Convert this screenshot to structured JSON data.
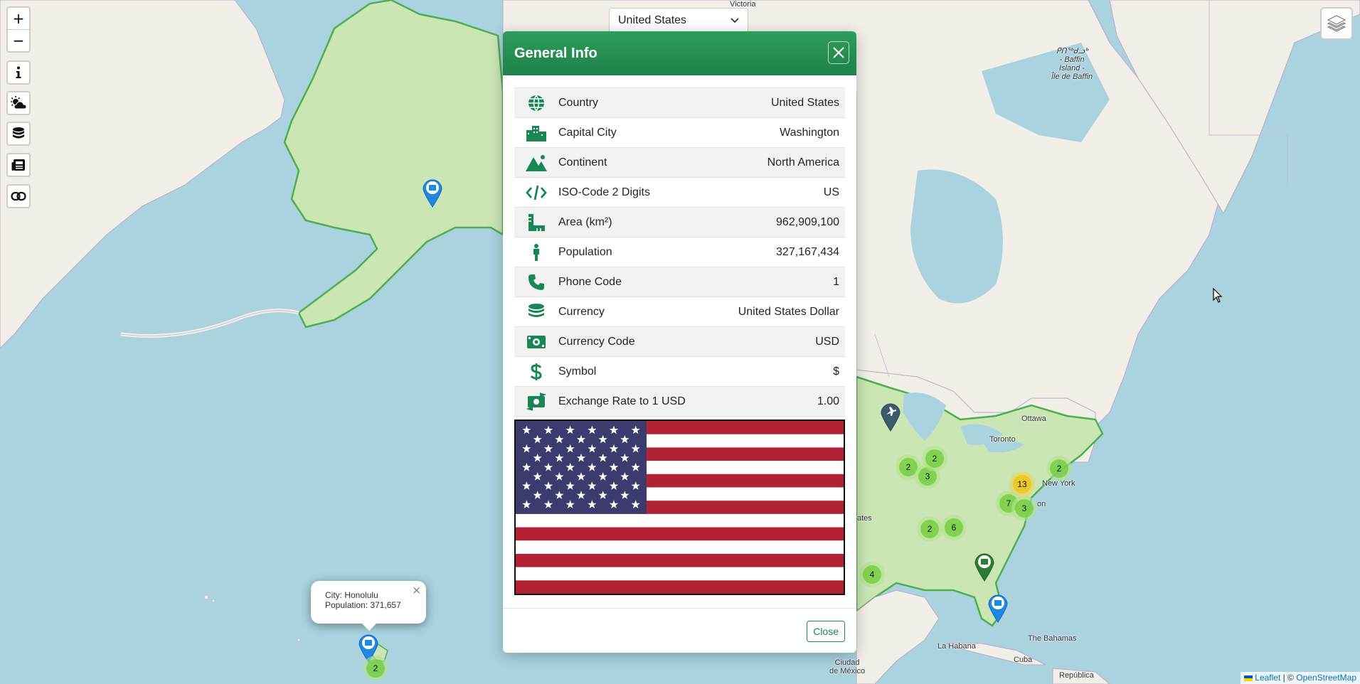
{
  "country_select": {
    "value": "United States"
  },
  "map_controls": {
    "zoom_in": "+",
    "zoom_out": "−",
    "info_icon": "info-icon",
    "weather_icon": "cloud-sun-icon",
    "currency_icon": "coins-icon",
    "news_icon": "newspaper-icon",
    "link_icon": "link-icon",
    "layers_icon": "layers-icon"
  },
  "map_labels": {
    "victoria": "Victoria\nd",
    "baffin": "ᑭᑎᖅᑯᓗᒃ\n- Baffin\nIsland -\nÎle de Baffin",
    "ottawa": "Ottawa",
    "toronto": "Toronto",
    "new_york": "New York",
    "washington_partial": "on",
    "states_partial": "ates",
    "la_habana": "La Habana",
    "bahamas": "The Bahamas",
    "cuba": "Cuba",
    "mexico": "Ciudad\nde México",
    "republica": "República"
  },
  "clusters": [
    "2",
    "3",
    "2",
    "13",
    "7",
    "3",
    "2",
    "2",
    "6",
    "4",
    "2"
  ],
  "popup": {
    "city": "City: Honolulu",
    "population": "Population: 371,657",
    "close": "×"
  },
  "attribution": {
    "leaflet": "Leaflet",
    "separator": " | © ",
    "osm": "OpenStreetMap"
  },
  "modal": {
    "title": "General Info",
    "close_label": "Close",
    "rows": [
      {
        "icon": "globe-icon",
        "label": "Country",
        "value": "United States"
      },
      {
        "icon": "city-icon",
        "label": "Capital City",
        "value": "Washington"
      },
      {
        "icon": "mountain-icon",
        "label": "Continent",
        "value": "North America"
      },
      {
        "icon": "code-icon",
        "label": "ISO-Code 2 Digits",
        "value": "US"
      },
      {
        "icon": "ruler-icon",
        "label": "Area (km²)",
        "value": "962,909,100"
      },
      {
        "icon": "person-icon",
        "label": "Population",
        "value": "327,167,434"
      },
      {
        "icon": "phone-icon",
        "label": "Phone Code",
        "value": "1"
      },
      {
        "icon": "coins-icon",
        "label": "Currency",
        "value": "United States Dollar"
      },
      {
        "icon": "money-bill-icon",
        "label": "Currency Code",
        "value": "USD"
      },
      {
        "icon": "dollar-sign-icon",
        "label": "Symbol",
        "value": "$"
      },
      {
        "icon": "money-bill-transfer-icon",
        "label": "Exchange Rate to 1 USD",
        "value": "1.00"
      }
    ]
  },
  "colors": {
    "accent": "#198754",
    "header": "#1e8148",
    "water": "#aad3df",
    "land": "#f2efe9",
    "highlight": "#c9e4b4",
    "flag_red": "#b22234",
    "flag_blue": "#3c3b6e"
  }
}
